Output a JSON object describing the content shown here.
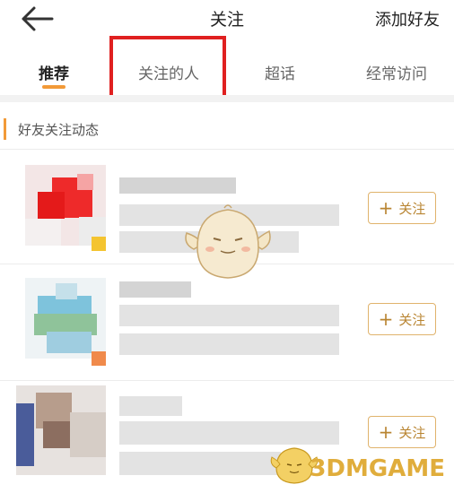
{
  "header": {
    "title": "关注",
    "add_friend_label": "添加好友"
  },
  "tabs": [
    {
      "label": "推荐",
      "active": true
    },
    {
      "label": "关注的人",
      "active": false
    },
    {
      "label": "超话",
      "active": false
    },
    {
      "label": "经常访问",
      "active": false
    }
  ],
  "section": {
    "title": "好友关注动态"
  },
  "rows": [
    {
      "follow_label": "关注"
    },
    {
      "follow_label": "关注"
    },
    {
      "follow_label": "关注"
    }
  ],
  "watermark": {
    "text": "3DMGAME"
  },
  "colors": {
    "accent": "#f29a38",
    "follow_border": "#e0b36c",
    "follow_text": "#b98532",
    "highlight_box": "#e02020"
  }
}
